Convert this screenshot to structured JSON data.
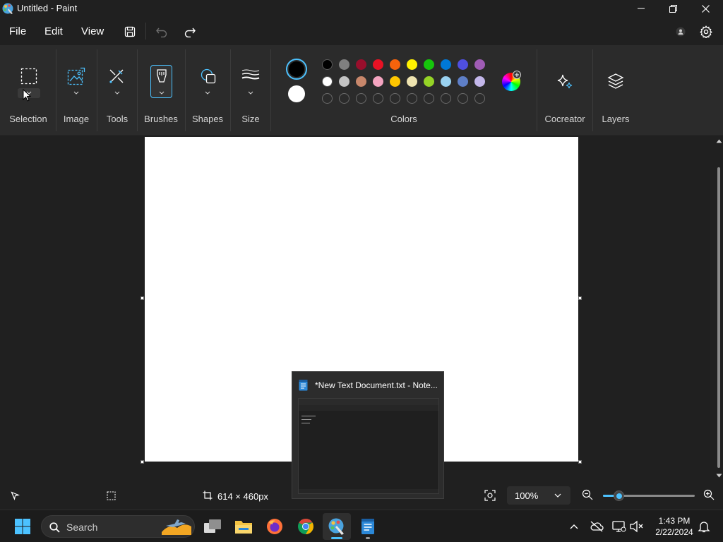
{
  "window": {
    "title": "Untitled - Paint",
    "app_icon": "paint-icon"
  },
  "menu": {
    "file": "File",
    "edit": "Edit",
    "view": "View"
  },
  "ribbon": {
    "selection": "Selection",
    "image": "Image",
    "tools": "Tools",
    "brushes": "Brushes",
    "shapes": "Shapes",
    "size": "Size",
    "colors": "Colors",
    "cocreator": "Cocreator",
    "layers": "Layers",
    "primary_color": "#000000",
    "secondary_color": "#ffffff",
    "palette_row1": [
      "#000000",
      "#7f7f7f",
      "#990f2c",
      "#e81224",
      "#f7630c",
      "#fff100",
      "#16c60c",
      "#0078d7",
      "#4f4fe0",
      "#a05cb5"
    ],
    "palette_row2": [
      "#ffffff",
      "#c3c3c3",
      "#c8876b",
      "#f4a4c0",
      "#ffc600",
      "#efe4b0",
      "#95d326",
      "#99d1f0",
      "#5e7fc7",
      "#c3b7ea"
    ],
    "custom_slots": 10
  },
  "canvas": {
    "background": "#ffffff"
  },
  "status": {
    "canvas_size": "614 × 460px",
    "zoom": "100%",
    "zoom_fraction": 0.17
  },
  "thumbnail": {
    "title": "*New Text Document.txt - Note..."
  },
  "taskbar": {
    "search_label": "Search",
    "time": "1:43 PM",
    "date": "2/22/2024"
  },
  "colors": {
    "accent": "#4cc2ff",
    "bg": "#202020",
    "ribbon": "#2b2b2b"
  }
}
